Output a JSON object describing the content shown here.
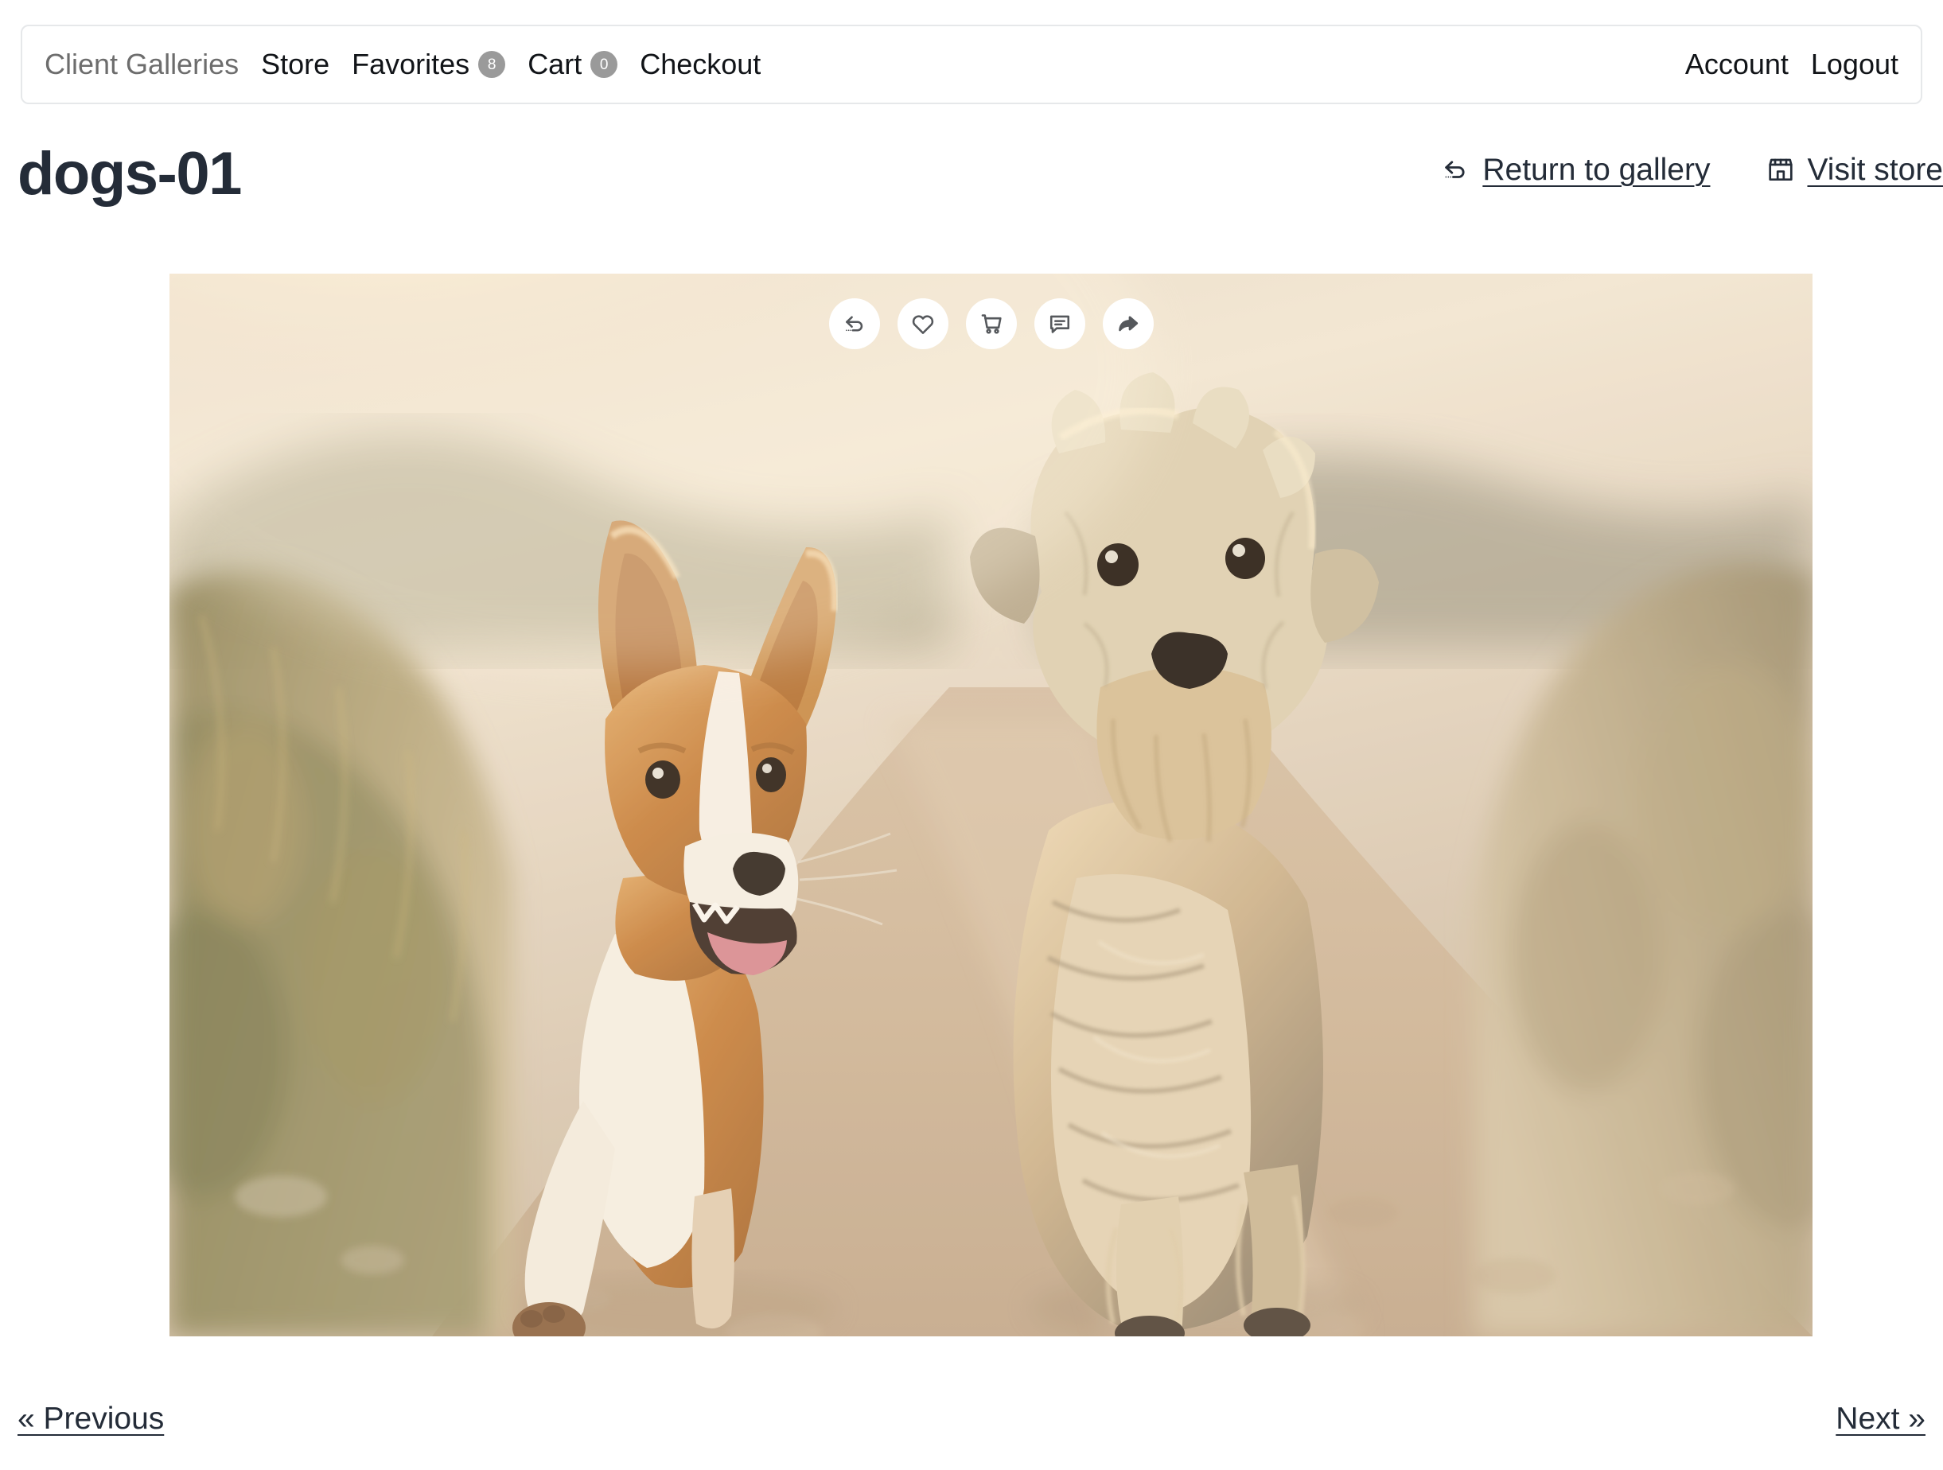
{
  "navbar": {
    "left_items": [
      {
        "label": "Client Galleries",
        "icon": "",
        "badge": null,
        "muted": true
      },
      {
        "label": "Store",
        "icon": "",
        "badge": null,
        "muted": false
      },
      {
        "label": "Favorites",
        "icon": "",
        "badge": "8",
        "muted": false
      },
      {
        "label": "Cart",
        "icon": "",
        "badge": "0",
        "muted": false
      },
      {
        "label": "Checkout",
        "icon": "",
        "badge": null,
        "muted": false
      }
    ],
    "right_items": [
      {
        "label": "Account"
      },
      {
        "label": "Logout"
      }
    ]
  },
  "header": {
    "title": "dogs-01",
    "return_link": "Return to gallery",
    "return_icon": "back-arrow-icon",
    "store_link": "Visit store",
    "store_icon": "storefront-icon"
  },
  "photo": {
    "alt": "Two dogs running on a dirt path at sunset",
    "toolbar": [
      {
        "name": "undo-icon",
        "tooltip": "Undo"
      },
      {
        "name": "heart-icon",
        "tooltip": "Favorite"
      },
      {
        "name": "cart-icon",
        "tooltip": "Add to cart"
      },
      {
        "name": "comment-icon",
        "tooltip": "Comment"
      },
      {
        "name": "share-icon",
        "tooltip": "Share"
      }
    ]
  },
  "pager": {
    "previous": "« Previous",
    "next": "Next »"
  },
  "colors": {
    "text": "#1f2733",
    "title": "#242c38",
    "muted": "#6d6d6d",
    "badge_bg": "#9a9a9a",
    "border": "#e6e8ea",
    "icon_stroke": "#55585c"
  }
}
